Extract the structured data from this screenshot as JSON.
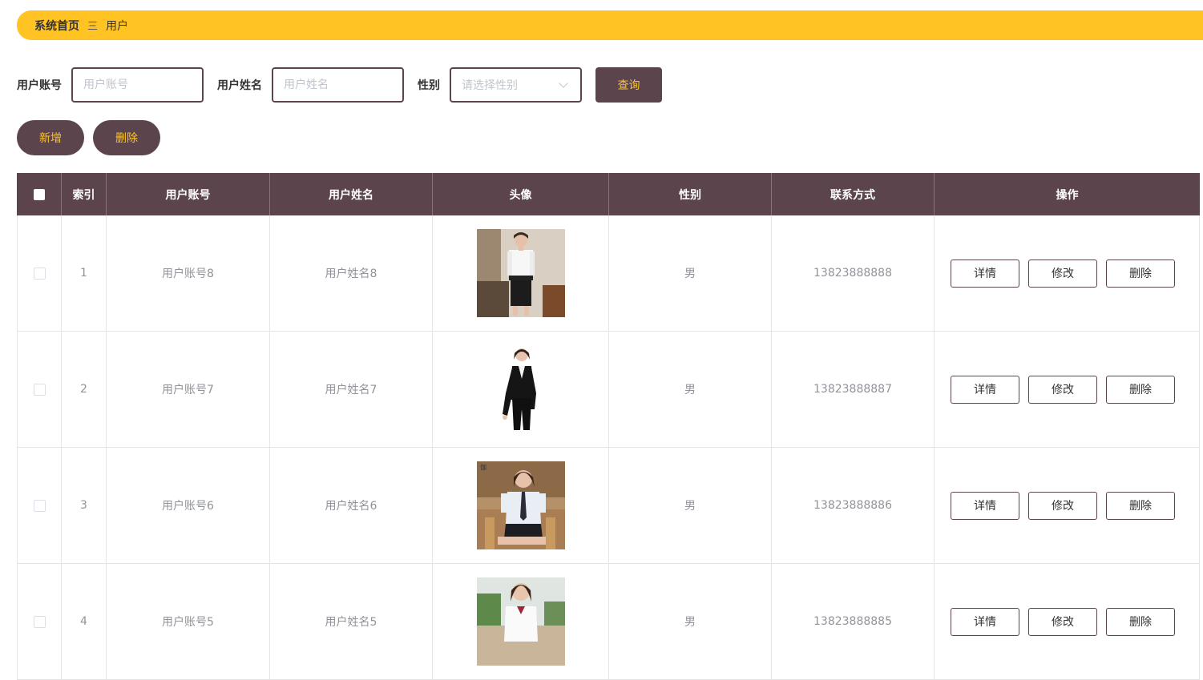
{
  "breadcrumb": {
    "home": "系统首页",
    "separator": "三",
    "current": "用户"
  },
  "search": {
    "account_label": "用户账号",
    "account_placeholder": "用户账号",
    "name_label": "用户姓名",
    "name_placeholder": "用户姓名",
    "gender_label": "性别",
    "gender_placeholder": "请选择性别",
    "query_label": "查询"
  },
  "actions": {
    "add_label": "新增",
    "delete_label": "删除"
  },
  "table": {
    "headers": [
      "索引",
      "用户账号",
      "用户姓名",
      "头像",
      "性别",
      "联系方式",
      "操作"
    ],
    "rows": [
      {
        "index": "1",
        "account": "用户账号8",
        "name": "用户姓名8",
        "gender": "男",
        "phone": "13823888888"
      },
      {
        "index": "2",
        "account": "用户账号7",
        "name": "用户姓名7",
        "gender": "男",
        "phone": "13823888887"
      },
      {
        "index": "3",
        "account": "用户账号6",
        "name": "用户姓名6",
        "gender": "男",
        "phone": "13823888886"
      },
      {
        "index": "4",
        "account": "用户账号5",
        "name": "用户姓名5",
        "gender": "男",
        "phone": "13823888885"
      }
    ],
    "ops": {
      "detail": "详情",
      "edit": "修改",
      "delete": "删除"
    }
  },
  "colors": {
    "accent": "#ffc423",
    "primary": "#5c444d"
  }
}
